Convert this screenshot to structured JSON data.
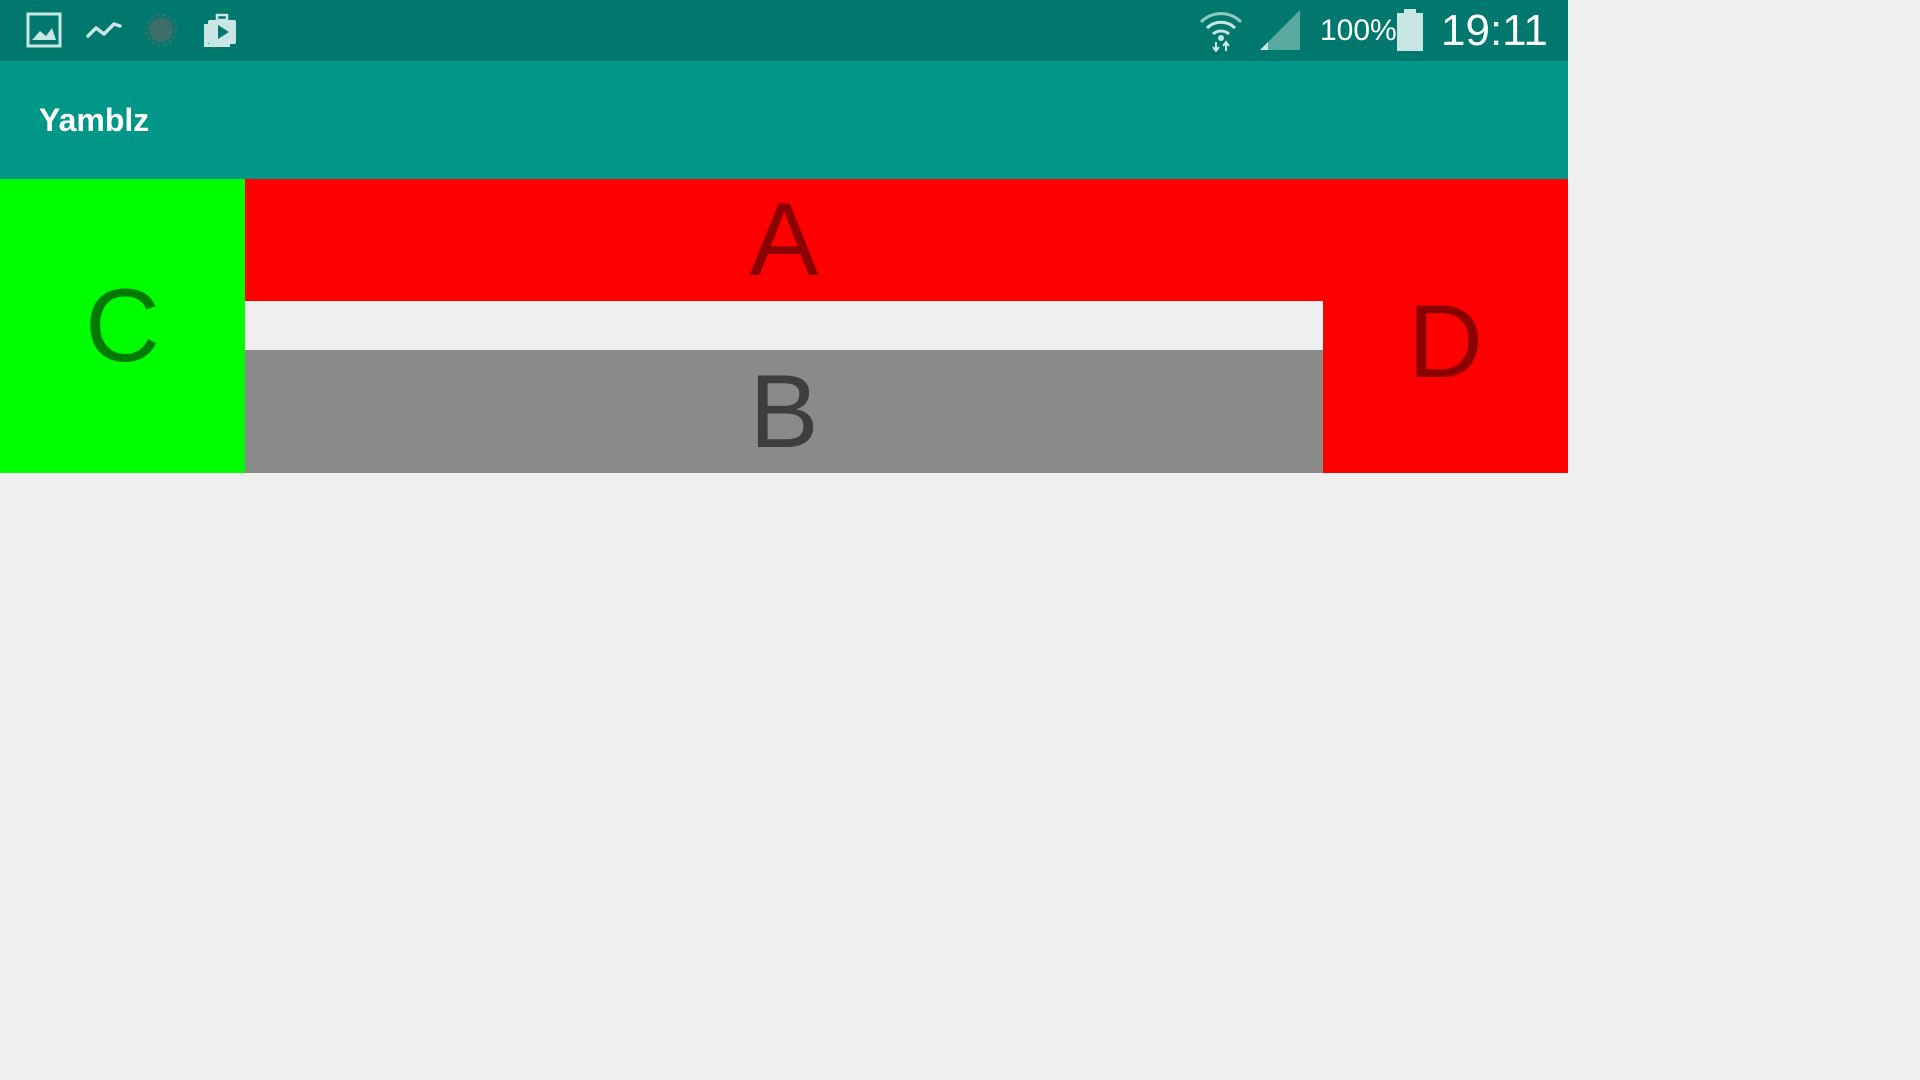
{
  "status_bar": {
    "left_icons": [
      "gallery-icon",
      "activity-chart-icon",
      "settings-dot-icon",
      "media-play-icon"
    ],
    "right_icons": [
      "wifi-icon",
      "signal-icon",
      "battery-icon"
    ],
    "battery_percent": "100%",
    "time": "19:11",
    "colors": {
      "background": "#00786e",
      "text": "#ffffff"
    }
  },
  "app_bar": {
    "title": "Yamblz",
    "colors": {
      "background": "#009688",
      "text": "#ffffff"
    }
  },
  "blocks": {
    "a": {
      "label": "A",
      "background": "#ff0000",
      "text_color": "#8b0000"
    },
    "b": {
      "label": "B",
      "background": "#8a8a8a",
      "text_color": "#3e3e3e"
    },
    "c": {
      "label": "C",
      "background": "#00ff00",
      "text_color": "#007a00"
    },
    "d": {
      "label": "D",
      "background": "#ff0000",
      "text_color": "#8b0000"
    }
  },
  "page": {
    "background": "#efefef"
  }
}
